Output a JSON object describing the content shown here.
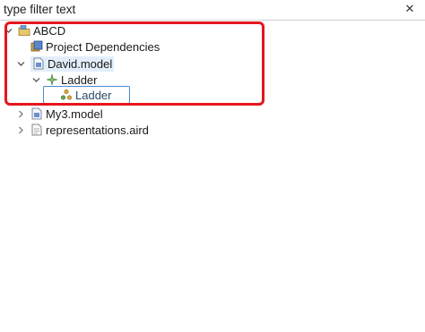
{
  "filter": {
    "placeholder": "type filter text",
    "value": "",
    "clear_icon": "close-icon"
  },
  "tree": {
    "root": {
      "label": "ABCD",
      "icon": "project-folder-icon",
      "expanded": true
    },
    "items": [
      {
        "label": "Project Dependencies",
        "icon": "dependencies-icon"
      },
      {
        "label": "David.model",
        "icon": "model-file-icon",
        "expanded": true
      },
      {
        "label": "Ladder",
        "icon": "class-icon",
        "expanded": true
      },
      {
        "label": "Ladder",
        "icon": "instance-icon"
      },
      {
        "label": "My3.model",
        "icon": "model-file-icon",
        "expanded": false
      },
      {
        "label": "representations.aird",
        "icon": "aird-file-icon",
        "expanded": false
      }
    ]
  },
  "colors": {
    "highlight": "#e5161d",
    "selection": "#e2eefa",
    "focus_border": "#4a8ac8"
  }
}
